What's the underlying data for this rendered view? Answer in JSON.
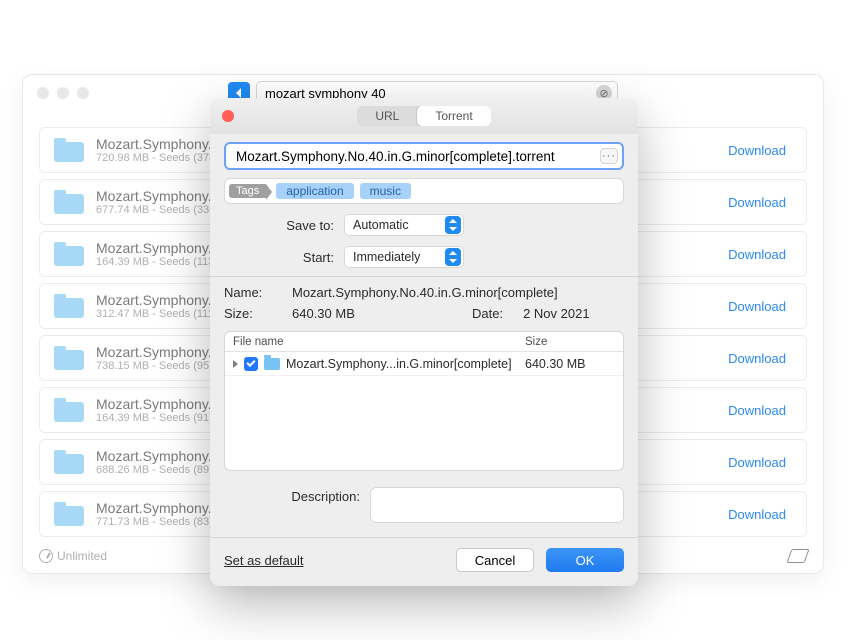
{
  "back_window": {
    "search_value": "mozart symphony 40",
    "results": [
      {
        "title": "Mozart.Symphony.",
        "subtitle": "720.98 MB - Seeds (378)"
      },
      {
        "title": "Mozart.Symphony.",
        "subtitle": "677.74 MB - Seeds (336)"
      },
      {
        "title": "Mozart.Symphony.",
        "subtitle": "164.39 MB - Seeds (113)"
      },
      {
        "title": "Mozart.Symphony.",
        "subtitle": "312.47 MB - Seeds (111)"
      },
      {
        "title": "Mozart.Symphony.",
        "subtitle": "738.15 MB - Seeds (95)"
      },
      {
        "title": "Mozart.Symphony.",
        "subtitle": "164.39 MB - Seeds (91)"
      },
      {
        "title": "Mozart.Symphony.",
        "subtitle": "688.26 MB - Seeds (89)"
      },
      {
        "title": "Mozart.Symphony.",
        "subtitle": "771.73 MB - Seeds (83)"
      }
    ],
    "download_label": "Download",
    "speed_label": "Unlimited"
  },
  "modal": {
    "tabs": {
      "url": "URL",
      "torrent": "Torrent",
      "active": "torrent"
    },
    "file_value": "Mozart.Symphony.No.40.in.G.minor[complete].torrent",
    "tags_label": "Tags",
    "tags": [
      "application",
      "music"
    ],
    "save_to_label": "Save to:",
    "save_to_value": "Automatic",
    "start_label": "Start:",
    "start_value": "Immediately",
    "name_label": "Name:",
    "name_value": "Mozart.Symphony.No.40.in.G.minor[complete]",
    "size_label": "Size:",
    "size_value": "640.30 MB",
    "date_label": "Date:",
    "date_value": "2 Nov 2021",
    "table": {
      "col_name": "File name",
      "col_size": "Size",
      "row_name": "Mozart.Symphony...in.G.minor[complete]",
      "row_size": "640.30 MB"
    },
    "description_label": "Description:",
    "set_default": "Set as default",
    "cancel": "Cancel",
    "ok": "OK"
  }
}
